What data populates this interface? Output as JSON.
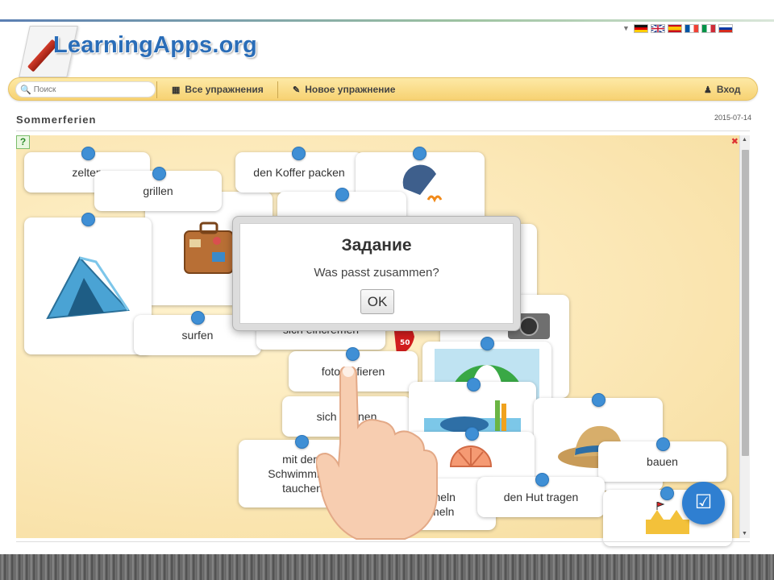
{
  "site": {
    "logo_text": "LearningApps.org"
  },
  "languages": [
    "de",
    "en",
    "es",
    "fr",
    "it",
    "ru"
  ],
  "nav": {
    "search_placeholder": "Поиск",
    "all_exercises": "Все упражнения",
    "new_exercise": "Новое упражнение",
    "login": "Вход"
  },
  "page": {
    "title": "Sommerferien",
    "date": "2015-07-14"
  },
  "cards": {
    "zelten": "zelten",
    "grillen": "grillen",
    "koffer": "den Koffer packen",
    "surfen": "surfen",
    "sich_eincremen": "sich eincremen",
    "fotografieren": "fotografieren",
    "sich_sonnen": "sich sonnen",
    "schnorcheln": "mit dem Schwimmrohr tauchen",
    "muscheln": "Muscheln sammeln",
    "hut": "den Hut tragen",
    "bauen": "bauen"
  },
  "dialog": {
    "title": "Задание",
    "text": "Was passt zusammen?",
    "ok": "OK"
  },
  "icons": [
    "search-icon",
    "grid-icon",
    "pencil-icon",
    "user-icon",
    "help-icon",
    "fullscreen-icon",
    "check-icon",
    "pointer-hand-icon"
  ],
  "colors": {
    "accent": "#3f8fd5",
    "navbar": "#f7d272",
    "logo": "#2a6db8"
  }
}
